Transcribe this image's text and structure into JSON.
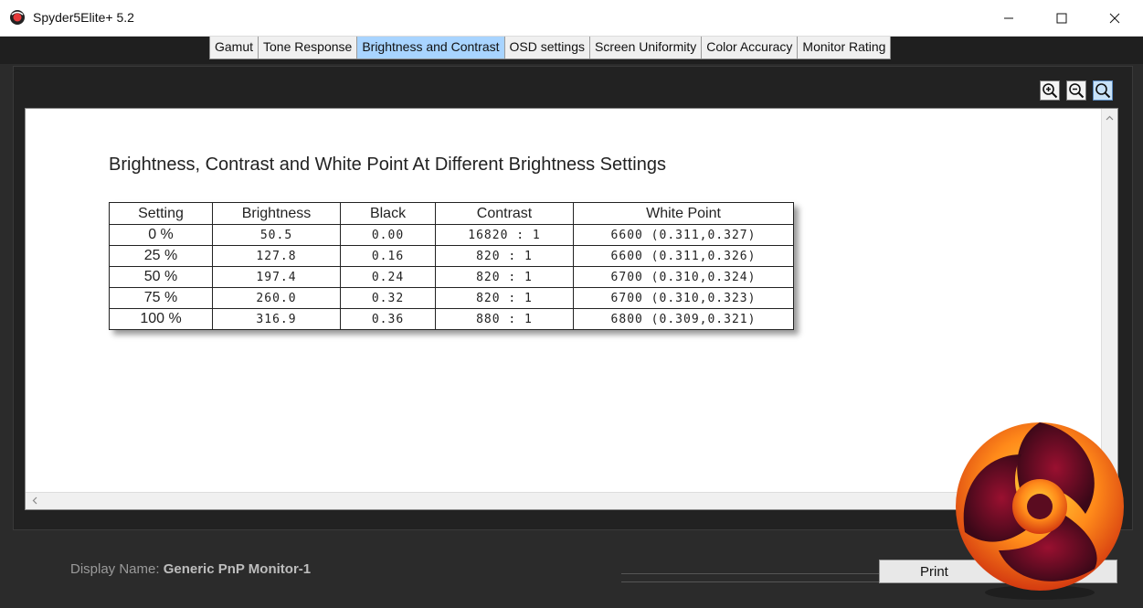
{
  "window": {
    "title": "Spyder5Elite+ 5.2"
  },
  "tabs": [
    {
      "label": "Gamut",
      "active": false
    },
    {
      "label": "Tone Response",
      "active": false
    },
    {
      "label": "Brightness and Contrast",
      "active": true
    },
    {
      "label": "OSD settings",
      "active": false
    },
    {
      "label": "Screen Uniformity",
      "active": false
    },
    {
      "label": "Color Accuracy",
      "active": false
    },
    {
      "label": "Monitor Rating",
      "active": false
    }
  ],
  "zoom_controls": {
    "icons": [
      "zoom-in-icon",
      "zoom-out-icon",
      "zoom-fit-icon"
    ],
    "active": "zoom-fit"
  },
  "report": {
    "title": "Brightness, Contrast and White Point At Different Brightness Settings",
    "columns": [
      "Setting",
      "Brightness",
      "Black",
      "Contrast",
      "White Point"
    ],
    "rows": [
      [
        "0 %",
        "50.5",
        "0.00",
        "16820 : 1",
        "6600 (0.311,0.327)"
      ],
      [
        "25 %",
        "127.8",
        "0.16",
        "820 : 1",
        "6600 (0.311,0.326)"
      ],
      [
        "50 %",
        "197.4",
        "0.24",
        "820 : 1",
        "6700 (0.310,0.324)"
      ],
      [
        "75 %",
        "260.0",
        "0.32",
        "820 : 1",
        "6700 (0.310,0.323)"
      ],
      [
        "100 %",
        "316.9",
        "0.36",
        "880 : 1",
        "6800 (0.309,0.321)"
      ]
    ]
  },
  "footer": {
    "display_label": "Display Name:",
    "display_value": "Generic PnP Monitor-1",
    "print_label": "Print"
  },
  "colors": {
    "active_tab": "#a8d4ff",
    "background": "#2b2b2b"
  }
}
